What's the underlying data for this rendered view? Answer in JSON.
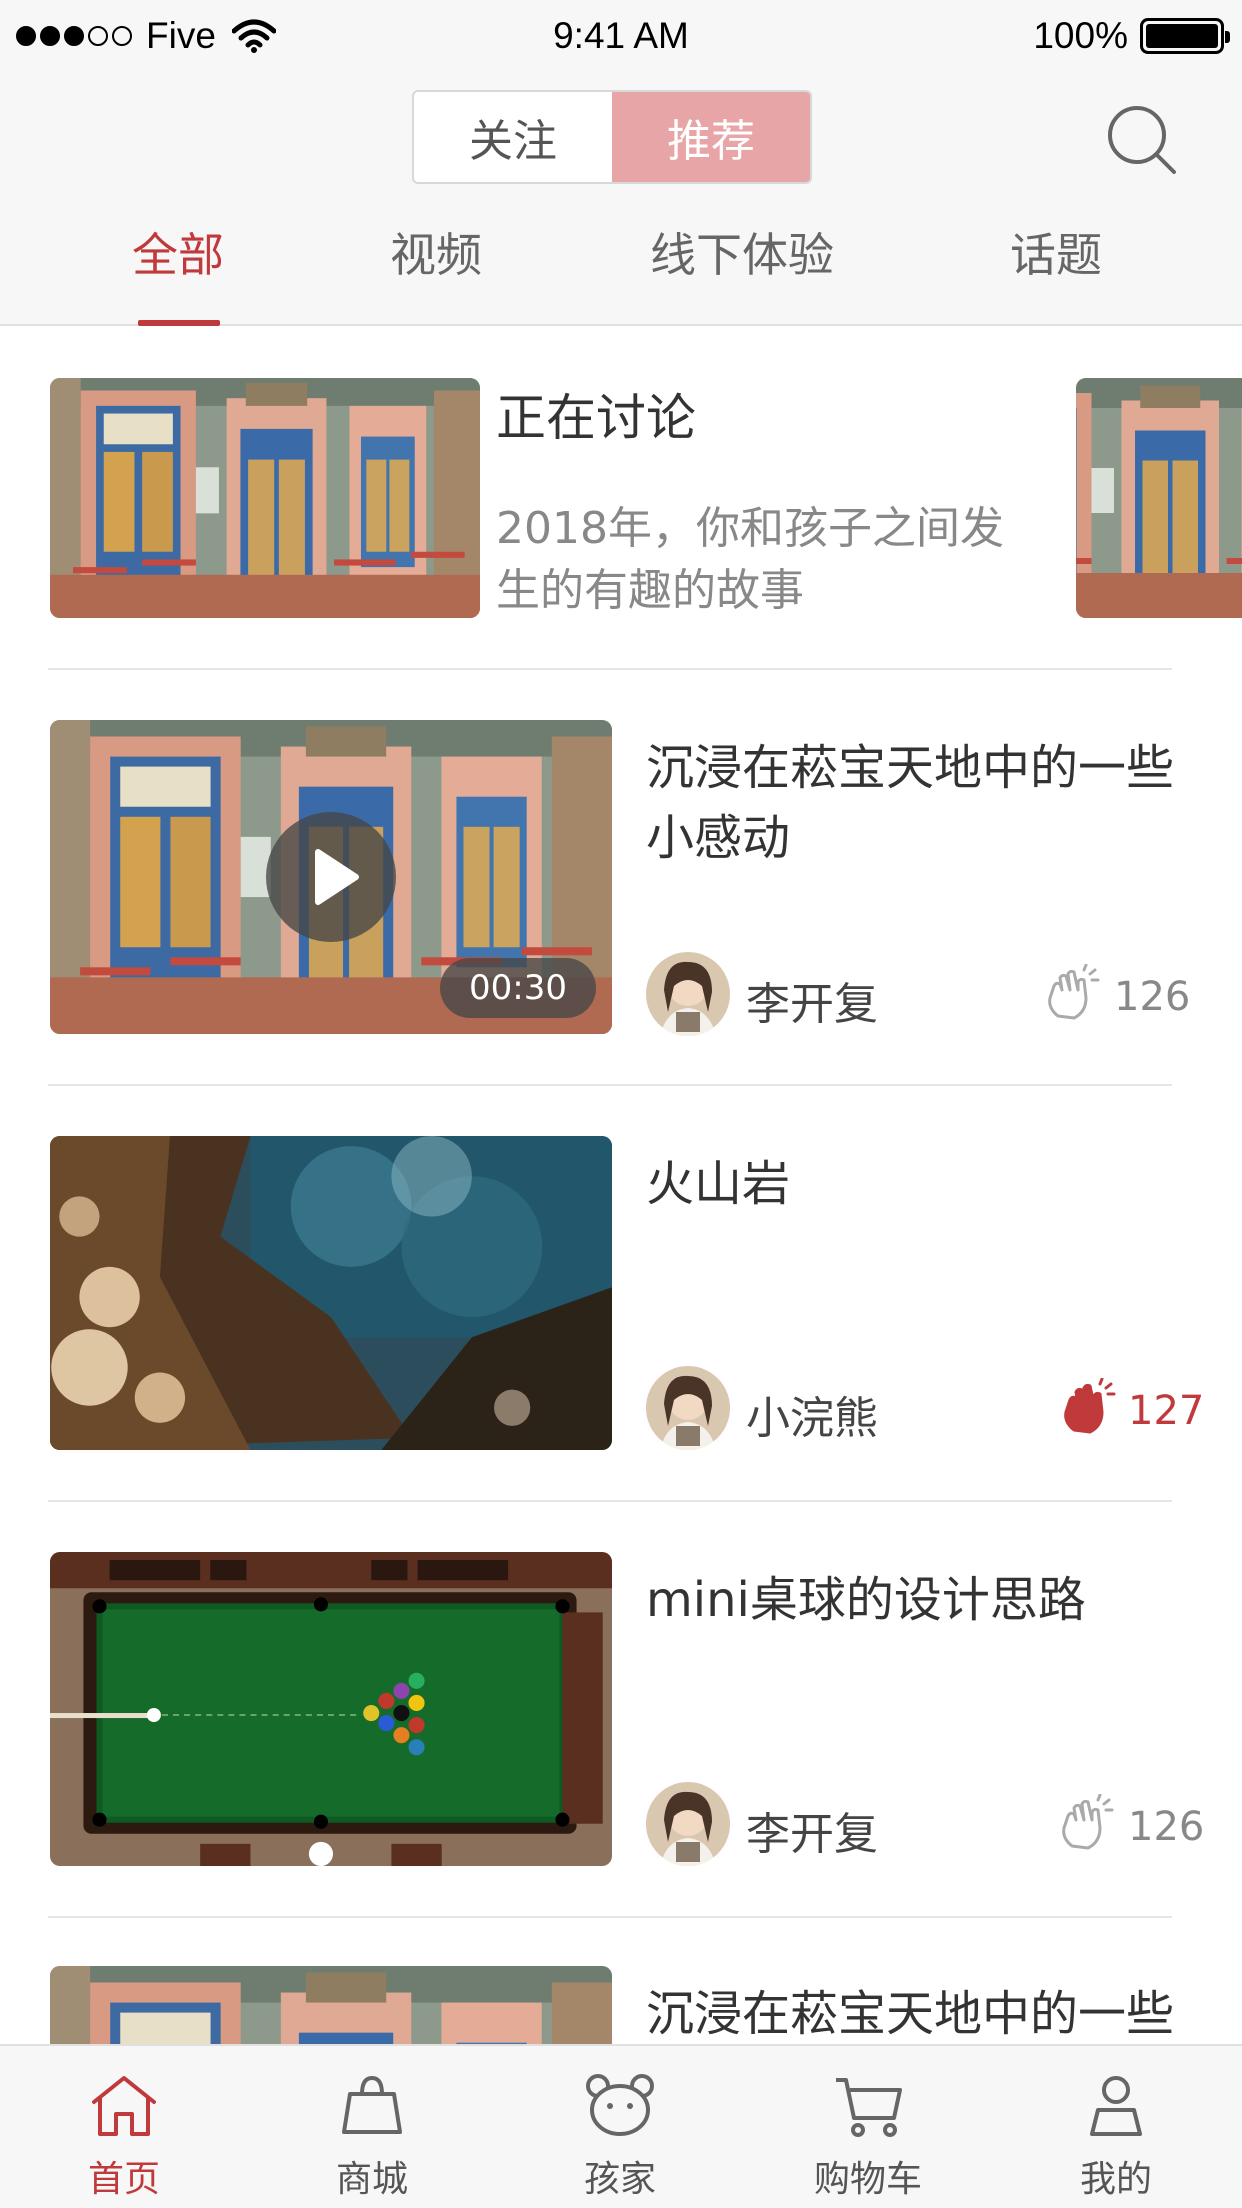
{
  "status_bar": {
    "carrier": "Five",
    "time": "9:41 AM",
    "battery": "100%"
  },
  "header": {
    "segments": [
      "关注",
      "推荐"
    ],
    "active_segment": "推荐",
    "tabs": [
      "全部",
      "视频",
      "线下体验",
      "话题"
    ],
    "active_tab": "全部"
  },
  "discussion": {
    "title": "正在讨论",
    "subtitle_lines": [
      "2018年，你和孩子之间发",
      "生的有趣的故事"
    ]
  },
  "feed": [
    {
      "title_lines": [
        "沉浸在菘宝天地中的一些",
        "小感动"
      ],
      "author": "李开复",
      "likes": "126",
      "liked": false,
      "video_duration": "00:30",
      "image": "street-cafe"
    },
    {
      "title_lines": [
        "火山岩"
      ],
      "author": "小浣熊",
      "likes": "127",
      "liked": true,
      "image": "volcanic-coast"
    },
    {
      "title_lines": [
        "mini桌球的设计思路"
      ],
      "author": "李开复",
      "likes": "126",
      "liked": false,
      "image": "billiards-game"
    },
    {
      "title_lines": [
        "沉浸在菘宝天地中的一些"
      ],
      "image": "street-cafe"
    }
  ],
  "tabbar": [
    {
      "label": "首页",
      "icon": "home-icon",
      "active": true
    },
    {
      "label": "商城",
      "icon": "shopping-bag-icon",
      "active": false
    },
    {
      "label": "孩家",
      "icon": "bear-icon",
      "active": false
    },
    {
      "label": "购物车",
      "icon": "cart-icon",
      "active": false
    },
    {
      "label": "我的",
      "icon": "user-icon",
      "active": false
    }
  ],
  "colors": {
    "accent": "#c0393b",
    "segment_active": "#e8a5a7",
    "background": "#f7f7f7"
  }
}
